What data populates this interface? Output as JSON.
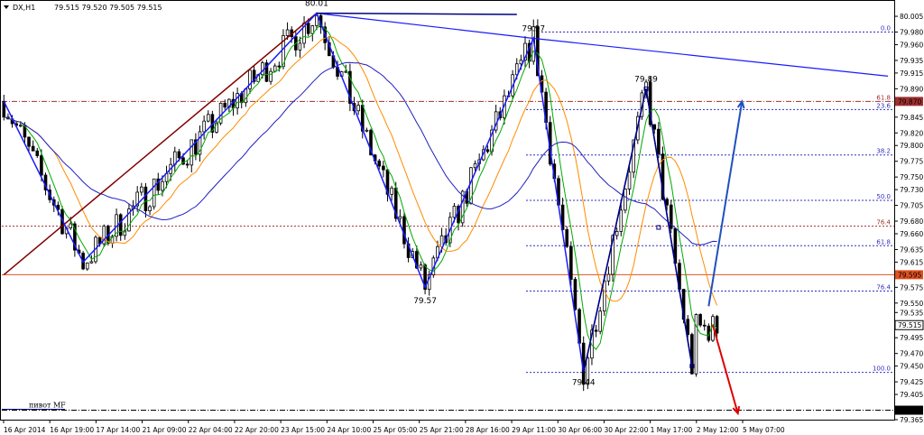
{
  "header": {
    "symbol": "DX,H1",
    "ohlc": "79.515 79.520 79.505 79.515"
  },
  "colors": {
    "background": "#ffffff",
    "grid": "#e6e6e6",
    "border": "#000000",
    "candle": "#000000",
    "ma_fast": "#00aa00",
    "ma_mid": "#ff8c00",
    "ma_slow": "#2020c0",
    "trendline": "#800000",
    "zigzag": "#1a1aff",
    "pattern": "#000080",
    "forecast_up": "#2050c0",
    "forecast_down": "#dd0000",
    "level_red": "#a03030",
    "level_blue": "#3030c0",
    "level_orange": "#e05020",
    "level_black": "#000000"
  },
  "chart_data": {
    "type": "candlestick",
    "y_axis": {
      "ticks": [
        "80.005",
        "79.980",
        "79.960",
        "79.935",
        "79.915",
        "79.890",
        "79.870",
        "79.845",
        "79.820",
        "79.800",
        "79.775",
        "79.750",
        "79.730",
        "79.705",
        "79.680",
        "79.660",
        "79.635",
        "79.615",
        "79.595",
        "79.575",
        "79.550",
        "79.535",
        "79.515",
        "79.495",
        "79.470",
        "79.450",
        "79.425",
        "79.405",
        "79.380",
        "79.365"
      ],
      "range": [
        79.365,
        80.028
      ],
      "position": "right"
    },
    "x_axis": {
      "ticks": [
        "16 Apr 2014",
        "16 Apr 19:00",
        "17 Apr 14:00",
        "21 Apr 09:00",
        "22 Apr 04:00",
        "22 Apr 20:00",
        "23 Apr 15:00",
        "24 Apr 10:00",
        "25 Apr 05:00",
        "25 Apr 21:00",
        "28 Apr 16:00",
        "29 Apr 11:00",
        "30 Apr 06:00",
        "30 Apr 22:00",
        "1 May 17:00",
        "2 May 12:00",
        "5 May 07:00"
      ]
    },
    "price_badges": [
      {
        "value": "79.870",
        "color": "#a03030"
      },
      {
        "value": "79.595",
        "color": "#e05020"
      },
      {
        "value": "79.515",
        "color": "#ffffff"
      },
      {
        "value": "79.380",
        "color": "#000000"
      }
    ],
    "horizontal_levels": [
      {
        "price": 80.04,
        "color": "#a03030",
        "style": "dot",
        "label": "50.0",
        "right_label": true
      },
      {
        "price": 79.98,
        "color": "#3030c0",
        "style": "dot",
        "label": "0.0",
        "right_label": true
      },
      {
        "price": 79.87,
        "color": "#a03030",
        "style": "dashdot",
        "label": "61.8"
      },
      {
        "price": 79.857,
        "color": "#3030c0",
        "style": "dot",
        "label": "23.6"
      },
      {
        "price": 79.785,
        "color": "#3030c0",
        "style": "dot",
        "label": "38.2"
      },
      {
        "price": 79.713,
        "color": "#3030c0",
        "style": "dot",
        "label": "50.0"
      },
      {
        "price": 79.672,
        "color": "#a03030",
        "style": "dot",
        "label": "76.4"
      },
      {
        "price": 79.641,
        "color": "#3030c0",
        "style": "dot",
        "label": "61.8"
      },
      {
        "price": 79.595,
        "color": "#e05020",
        "style": "solid",
        "label": ""
      },
      {
        "price": 79.569,
        "color": "#3030c0",
        "style": "dot",
        "label": "76.4"
      },
      {
        "price": 79.44,
        "color": "#3030c0",
        "style": "dot",
        "label": "100.0"
      },
      {
        "price": 79.38,
        "color": "#000000",
        "style": "dashdot",
        "label": ""
      }
    ],
    "price_labels": [
      {
        "text": "80.01",
        "price": 80.01,
        "bar": 75
      },
      {
        "text": "79.97",
        "price": 79.97,
        "bar": 127
      },
      {
        "text": "79.89",
        "price": 79.89,
        "bar": 154
      },
      {
        "text": "79.57",
        "price": 79.57,
        "bar": 101
      },
      {
        "text": "79.44",
        "price": 79.44,
        "bar": 139
      }
    ],
    "pivot_labels": [
      {
        "text": "пивот MF",
        "price": 80.04,
        "bar": 108
      },
      {
        "text": "пивот MF",
        "price": 79.38,
        "bar": 6
      }
    ],
    "zigzag": [
      {
        "bar": 0,
        "price": 79.87
      },
      {
        "bar": 19,
        "price": 79.615
      },
      {
        "bar": 75,
        "price": 80.01
      },
      {
        "bar": 101,
        "price": 79.575
      },
      {
        "bar": 127,
        "price": 79.97
      },
      {
        "bar": 139,
        "price": 79.44
      },
      {
        "bar": 154,
        "price": 79.89
      },
      {
        "bar": 165,
        "price": 79.45
      }
    ],
    "trendline": [
      {
        "bar": 0,
        "price": 79.595
      },
      {
        "bar": 75,
        "price": 80.01
      }
    ],
    "resistance_line": [
      {
        "bar": 75,
        "price": 80.01
      },
      {
        "bar": 127,
        "price": 79.97
      },
      {
        "bar": 212,
        "price": 79.91
      }
    ],
    "flat_line": [
      {
        "bar": 75,
        "price": 80.01
      },
      {
        "bar": 123,
        "price": 80.008
      }
    ],
    "forecast_up": [
      {
        "bar": 169,
        "price": 79.545
      },
      {
        "bar": 177,
        "price": 79.87
      }
    ],
    "forecast_down": [
      {
        "bar": 170,
        "price": 79.515
      },
      {
        "bar": 176,
        "price": 79.375
      }
    ],
    "candles": []
  }
}
